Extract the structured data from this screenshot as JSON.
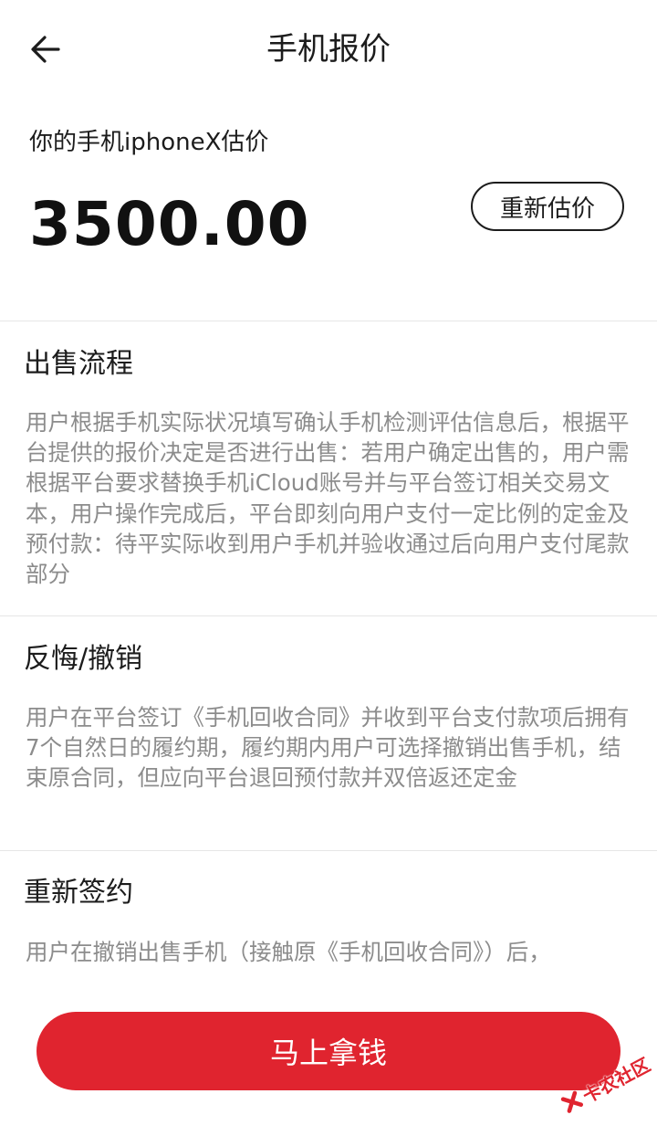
{
  "header": {
    "title": "手机报价",
    "back_icon": "arrow-left-icon"
  },
  "quote": {
    "label": "你的手机iphoneX估价",
    "value": "3500.00",
    "reestimate_label": "重新估价"
  },
  "sections": [
    {
      "title": "出售流程",
      "body": "用户根据手机实际状况填写确认手机检测评估信息后，根据平台提供的报价决定是否进行出售：若用户确定出售的，用户需根据平台要求替换手机iCloud账号并与平台签订相关交易文本，用户操作完成后，平台即刻向用户支付一定比例的定金及预付款：待平实际收到用户手机并验收通过后向用户支付尾款部分"
    },
    {
      "title": "反悔/撤销",
      "body": "用户在平台签订《手机回收合同》并收到平台支付款项后拥有7个自然日的履约期，履约期内用户可选择撤销出售手机，结束原合同，但应向平台退回预付款并双倍返还定金"
    },
    {
      "title": "重新签约",
      "body": "用户在撤销出售手机（接触原《手机回收合同》）后，"
    }
  ],
  "footer": {
    "cta_label": "马上拿钱"
  },
  "watermark": {
    "text": "卡农社区"
  },
  "colors": {
    "accent": "#e0242f",
    "body_text": "#8c8c8c",
    "divider": "#e6e6e6"
  }
}
